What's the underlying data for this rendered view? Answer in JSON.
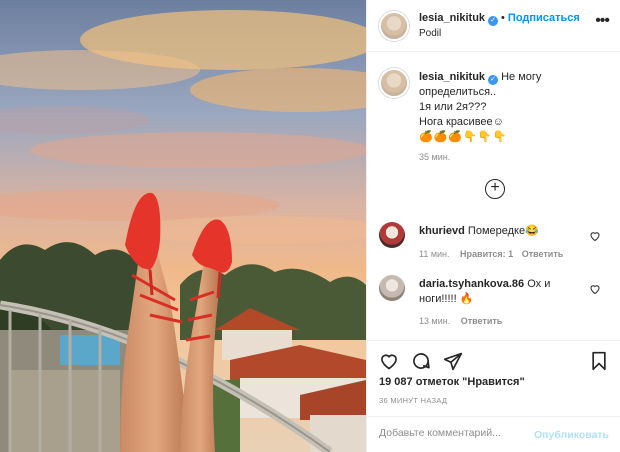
{
  "header": {
    "username": "lesia_nikituk",
    "follow_label": "Подписаться",
    "location": "Podil"
  },
  "caption": {
    "username": "lesia_nikituk",
    "lines": [
      "Не могу",
      "определиться..",
      "1я или 2я???",
      "Нога красивее☺"
    ],
    "emojis": "🍊🍊🍊👇👇👇",
    "time": "35 мин."
  },
  "comments": [
    {
      "username": "khurievd",
      "text": "Помередке😂",
      "time": "11 мин.",
      "likes": "Нравится: 1",
      "reply": "Ответить"
    },
    {
      "username": "daria.tsyhankova.86",
      "text": "Ох и ноги!!!!! 🔥",
      "time": "13 мин.",
      "reply": "Ответить"
    }
  ],
  "likes_text": "19 087 отметок \"Нравится\"",
  "posted_ago": "36 МИНУТ НАЗАД",
  "add_comment": {
    "placeholder": "Добавьте комментарий...",
    "publish_label": "Опубликовать"
  },
  "icons": {
    "verified": "verified-badge-icon",
    "more": "more-options-icon",
    "load_more": "plus-circle-icon",
    "like": "heart-icon",
    "comment": "comment-icon",
    "share": "share-icon",
    "save": "bookmark-icon"
  }
}
